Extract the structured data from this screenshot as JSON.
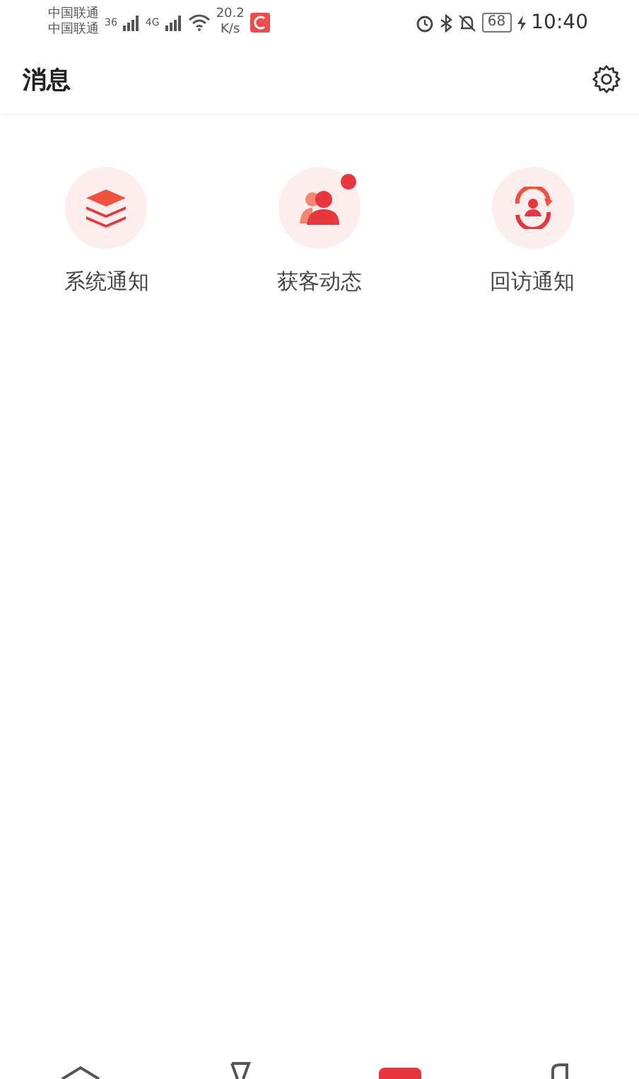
{
  "status_bar": {
    "carriers": [
      "中国联通",
      "中国联通"
    ],
    "network_1": "36",
    "network_2": "4G",
    "speed": "20.2",
    "speed_unit": "K/s",
    "battery": "68",
    "time": "10:40"
  },
  "header": {
    "title": "消息"
  },
  "categories": [
    {
      "kind": "layers",
      "label": "系统通知",
      "unread": false
    },
    {
      "kind": "people",
      "label": "获客动态",
      "unread": true
    },
    {
      "kind": "revisit",
      "label": "回访通知",
      "unread": false
    }
  ],
  "bottom_nav": [
    {
      "kind": "home"
    },
    {
      "kind": "cup"
    },
    {
      "kind": "center"
    },
    {
      "kind": "page"
    }
  ]
}
